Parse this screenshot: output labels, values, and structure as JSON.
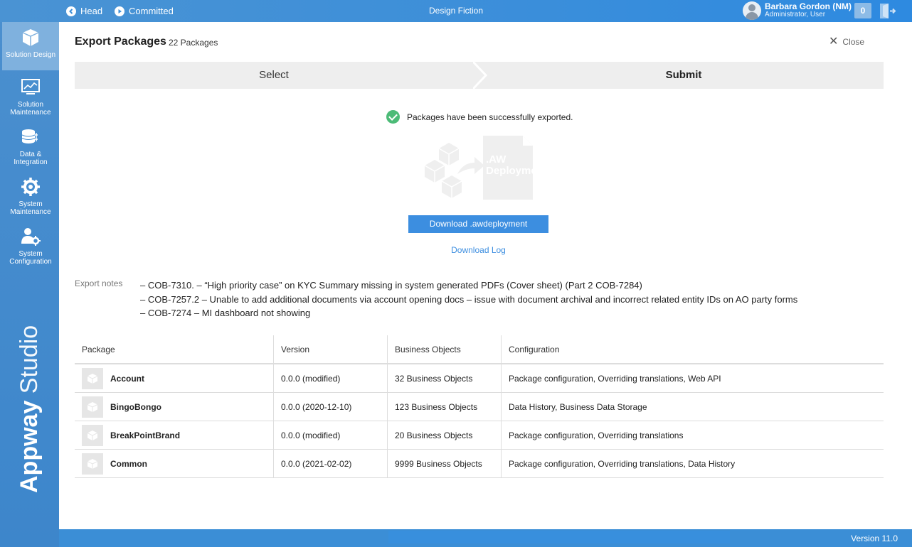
{
  "topbar": {
    "head_label": "Head",
    "committed_label": "Committed",
    "title": "Design Fiction",
    "user_name": "Barbara Gordon (NM)",
    "user_role": "Administrator, User",
    "notification_count": "0"
  },
  "sidebar": {
    "items": [
      {
        "label": "Solution Design",
        "icon": "cubes-icon",
        "active": true
      },
      {
        "label": "Solution Maintenance",
        "icon": "monitor-chart-icon",
        "active": false
      },
      {
        "label": "Data & Integration",
        "icon": "database-icon",
        "active": false
      },
      {
        "label": "System Maintenance",
        "icon": "gear-icon",
        "active": false
      },
      {
        "label": "System Configuration",
        "icon": "user-gear-icon",
        "active": false
      }
    ],
    "brand_bold": "Appway",
    "brand_light": " Studio"
  },
  "main": {
    "title": "Export Packages",
    "count": "22 Packages",
    "close_label": "Close",
    "steps": [
      "Select",
      "Submit"
    ],
    "success_message": "Packages have been successfully exported.",
    "doc_label": ".AW Deployment",
    "download_button": "Download .awdeployment",
    "download_log": "Download Log",
    "notes_label": "Export notes",
    "notes": [
      "– COB-7310. – “High priority case” on KYC Summary missing in system generated PDFs (Cover sheet) (Part 2 COB-7284)",
      "– COB-7257.2 – Unable to add additional documents via account opening docs – issue with document archival and incorrect related entity IDs on AO party forms",
      "– COB-7274 – MI dashboard not showing"
    ],
    "table": {
      "headers": [
        "Package",
        "Version",
        "Business Objects",
        "Configuration"
      ],
      "rows": [
        [
          "Account",
          "0.0.0 (modified)",
          "32 Business Objects",
          "Package configuration, Overriding translations, Web API"
        ],
        [
          "BingoBongo",
          "0.0.0 (2020-12-10)",
          "123 Business Objects",
          "Data History, Business Data Storage"
        ],
        [
          "BreakPointBrand",
          "0.0.0 (modified)",
          "20 Business Objects",
          "Package configuration, Overriding translations"
        ],
        [
          "Common",
          "0.0.0 (2021-02-02)",
          "9999 Business Objects",
          "Package configuration, Overriding translations, Data History"
        ]
      ]
    }
  },
  "footer": {
    "version": "Version 11.0"
  },
  "colors": {
    "accent": "#3c8ee0",
    "success": "#4cbb77",
    "sidebar_active": "#7fb1de"
  }
}
